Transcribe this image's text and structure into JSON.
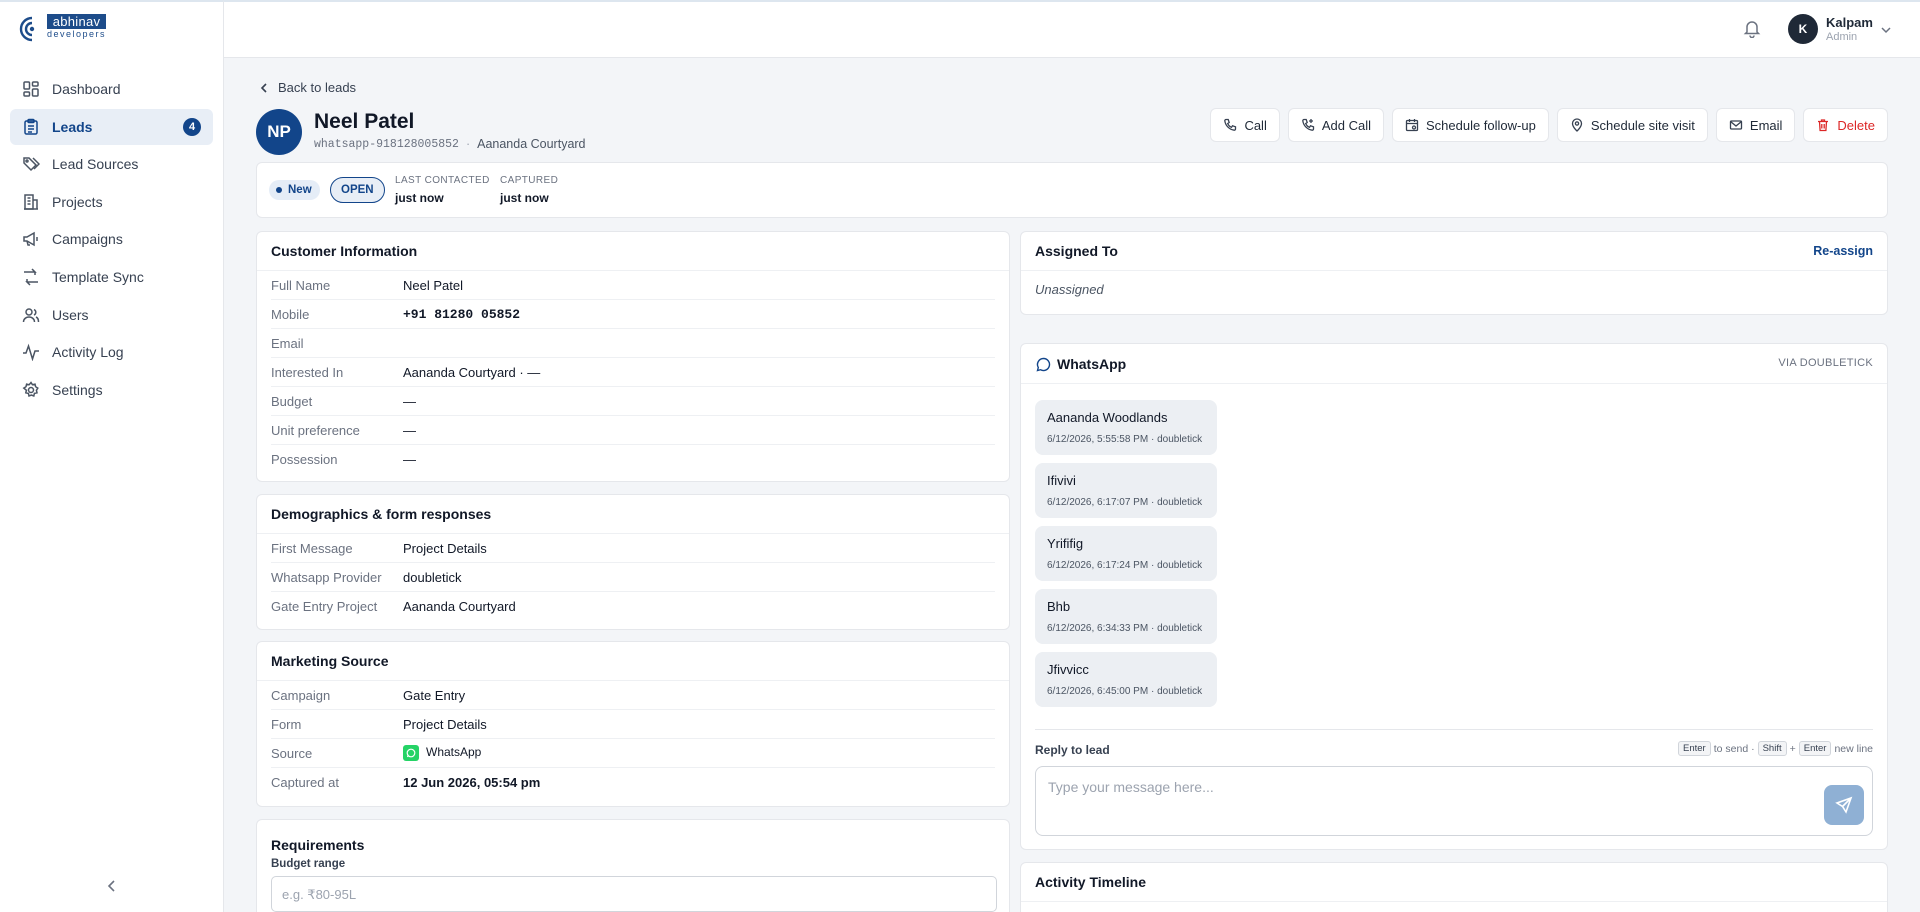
{
  "brand": {
    "name": "abhinav",
    "tagline": "developers"
  },
  "sidebar": {
    "items": [
      {
        "label": "Dashboard",
        "icon": "dashboard-icon"
      },
      {
        "label": "Leads",
        "icon": "clipboard-icon",
        "badge": "4",
        "active": true
      },
      {
        "label": "Lead Sources",
        "icon": "tags-icon"
      },
      {
        "label": "Projects",
        "icon": "building-icon"
      },
      {
        "label": "Campaigns",
        "icon": "megaphone-icon"
      },
      {
        "label": "Template Sync",
        "icon": "sync-icon"
      },
      {
        "label": "Users",
        "icon": "users-icon"
      },
      {
        "label": "Activity Log",
        "icon": "activity-icon"
      },
      {
        "label": "Settings",
        "icon": "gear-icon"
      }
    ]
  },
  "user": {
    "initial": "K",
    "name": "Kalpam",
    "role": "Admin"
  },
  "nav": {
    "back_label": "Back to leads"
  },
  "lead": {
    "initials": "NP",
    "name": "Neel Patel",
    "source_id": "whatsapp-918128005852",
    "separator": "·",
    "project": "Aananda Courtyard"
  },
  "actions": [
    {
      "label": "Call",
      "icon": "phone-icon"
    },
    {
      "label": "Add Call",
      "icon": "phone-plus-icon"
    },
    {
      "label": "Schedule follow-up",
      "icon": "calendar-icon"
    },
    {
      "label": "Schedule site visit",
      "icon": "map-pin-icon"
    },
    {
      "label": "Email",
      "icon": "mail-icon"
    },
    {
      "label": "Delete",
      "icon": "trash-icon",
      "danger": true
    }
  ],
  "status": {
    "stage": "New",
    "state": "OPEN",
    "last_contacted_label": "LAST CONTACTED",
    "last_contacted_value": "just now",
    "captured_label": "CAPTURED",
    "captured_value": "just now"
  },
  "customer_info": {
    "title": "Customer Information",
    "rows": [
      {
        "k": "Full Name",
        "v": "Neel Patel"
      },
      {
        "k": "Mobile",
        "v": "+91 81280 05852"
      },
      {
        "k": "Email",
        "v": ""
      },
      {
        "k": "Interested In",
        "v": "Aananda Courtyard · —"
      },
      {
        "k": "Budget",
        "v": "—"
      },
      {
        "k": "Unit preference",
        "v": "—"
      },
      {
        "k": "Possession",
        "v": "—"
      }
    ]
  },
  "demographics": {
    "title": "Demographics & form responses",
    "rows": [
      {
        "k": "First Message",
        "v": "Project Details"
      },
      {
        "k": "Whatsapp Provider",
        "v": "doubletick"
      },
      {
        "k": "Gate Entry Project",
        "v": "Aananda Courtyard"
      }
    ]
  },
  "marketing": {
    "title": "Marketing Source",
    "rows": [
      {
        "k": "Campaign",
        "v": "Gate Entry"
      },
      {
        "k": "Form",
        "v": "Project Details"
      },
      {
        "k": "Source",
        "v": "WhatsApp"
      },
      {
        "k": "Captured at",
        "v": "12 Jun 2026, 05:54 pm"
      }
    ]
  },
  "requirements": {
    "title": "Requirements",
    "budget_label": "Budget range",
    "budget_placeholder": "e.g. ₹80-95L",
    "budget_value": ""
  },
  "assigned": {
    "title": "Assigned To",
    "action": "Re-assign",
    "value": "Unassigned"
  },
  "whatsapp": {
    "title": "WhatsApp",
    "via": "VIA DOUBLETICK",
    "messages": [
      {
        "text": "Aananda Woodlands",
        "meta": "6/12/2026, 5:55:58 PM · doubletick"
      },
      {
        "text": "Ifivivi",
        "meta": "6/12/2026, 6:17:07 PM · doubletick"
      },
      {
        "text": "Yrififig",
        "meta": "6/12/2026, 6:17:24 PM · doubletick"
      },
      {
        "text": "Bhb",
        "meta": "6/12/2026, 6:34:33 PM · doubletick"
      },
      {
        "text": "Jfivvicc",
        "meta": "6/12/2026, 6:45:00 PM · doubletick"
      }
    ],
    "reply_label": "Reply to lead",
    "hint": {
      "k1": "Enter",
      "t1": "to send ·",
      "k2": "Shift",
      "plus": "+",
      "k3": "Enter",
      "t2": "new line"
    },
    "placeholder": "Type your message here...",
    "input_value": ""
  },
  "timeline": {
    "title": "Activity Timeline"
  },
  "colors": {
    "accent": "#12458a",
    "danger": "#dc2626",
    "whatsapp": "#25d366",
    "send_disabled": "#8fb0d4"
  }
}
